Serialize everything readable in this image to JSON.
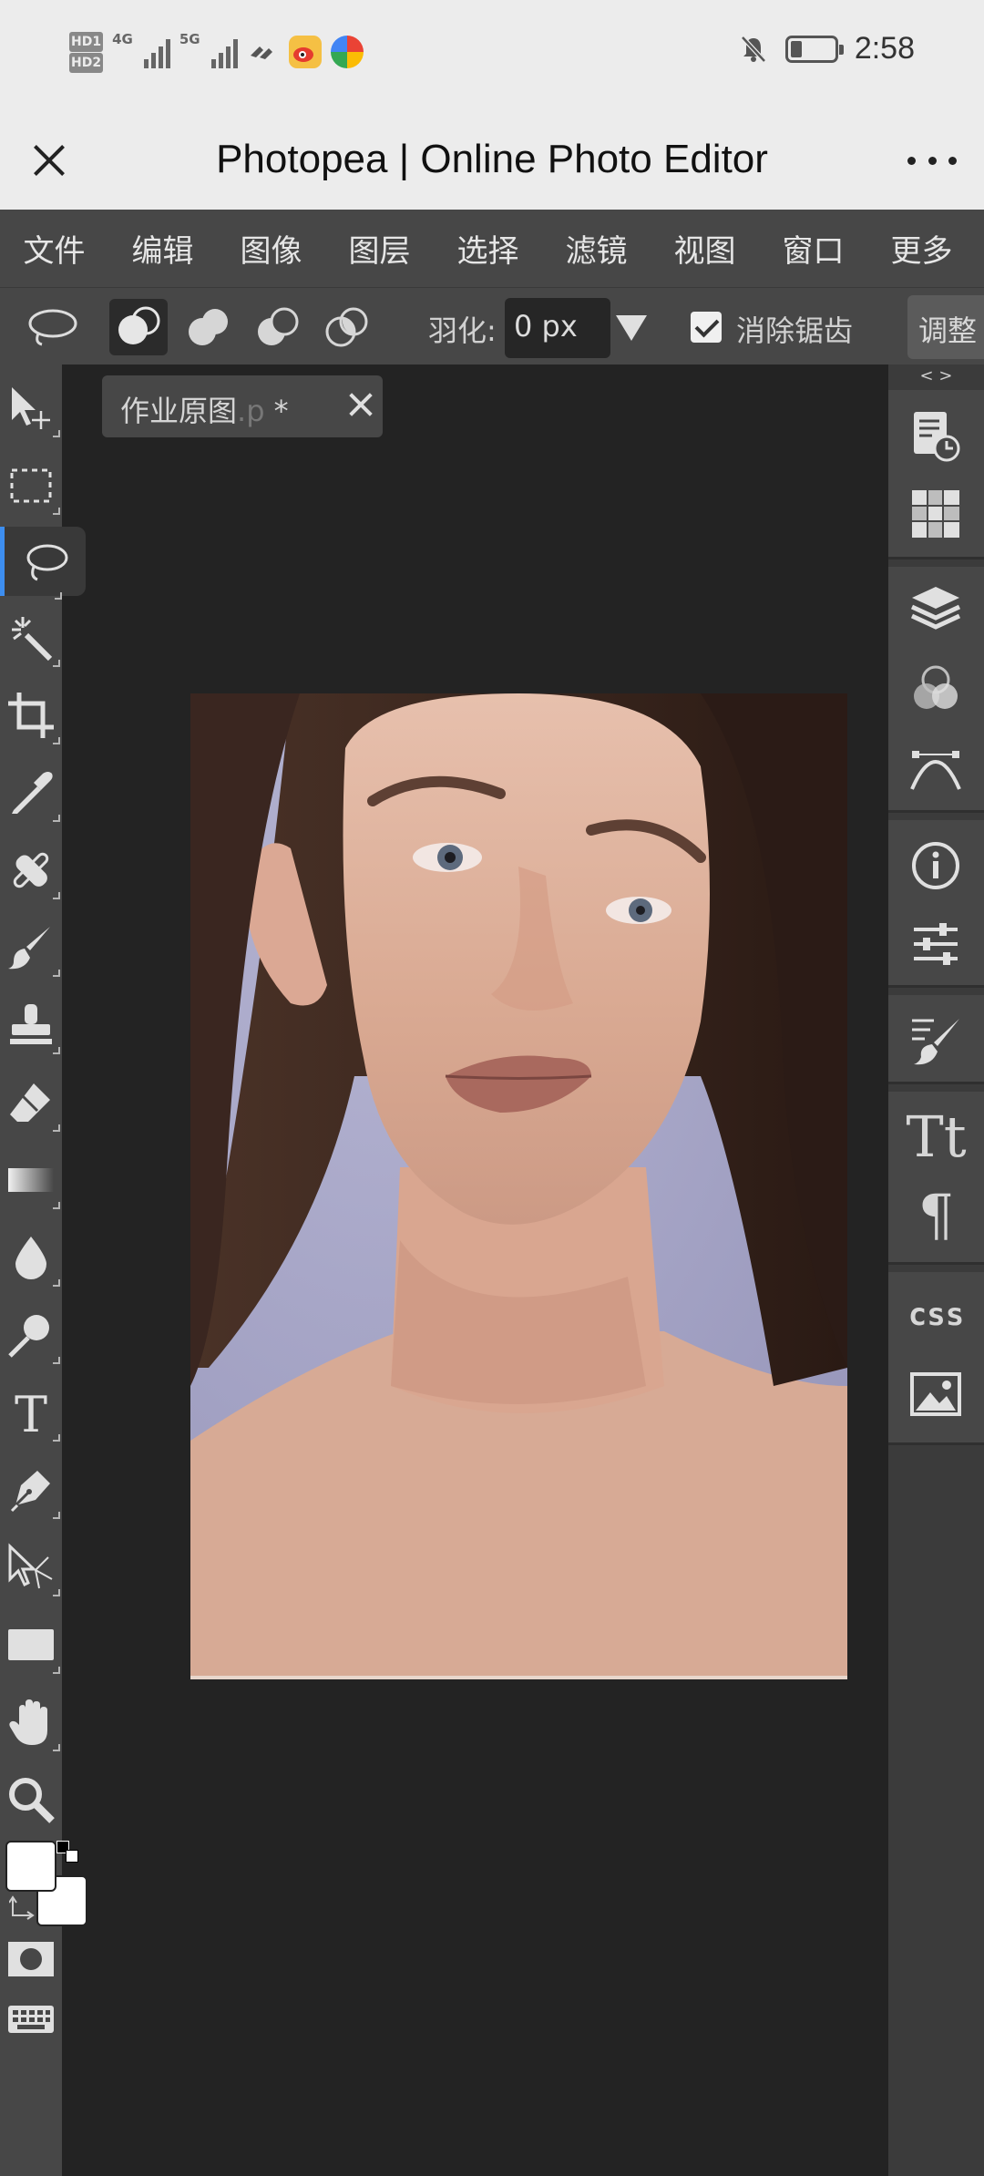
{
  "status_bar": {
    "network_labels": [
      "HD1",
      "HD2",
      "4G",
      "5G"
    ],
    "time": "2:58",
    "icons": [
      "signal-icon",
      "wifi-icon",
      "weibo-icon",
      "app-icon",
      "mute-icon",
      "battery-icon"
    ]
  },
  "browser": {
    "title": "Photopea | Online Photo Editor",
    "close_icon": "close-icon",
    "more_icon": "more-icon"
  },
  "menu": {
    "items": [
      "文件",
      "编辑",
      "图像",
      "图层",
      "选择",
      "滤镜",
      "视图",
      "窗口",
      "更多"
    ]
  },
  "options": {
    "feather_label": "羽化:",
    "feather_value": "0 px",
    "antialias_label": "消除锯齿",
    "antialias_checked": true,
    "adjust_label": "调整"
  },
  "document": {
    "tab_name": "作业原图",
    "tab_ext": ".p",
    "tab_modified": " *"
  },
  "right_panel": {
    "toggle": "< >",
    "css_label": "css"
  },
  "colors": {
    "accent": "#3d8ef0",
    "panel": "#474747",
    "workspace": "#232323",
    "photo_background": "#a7a6c6"
  }
}
